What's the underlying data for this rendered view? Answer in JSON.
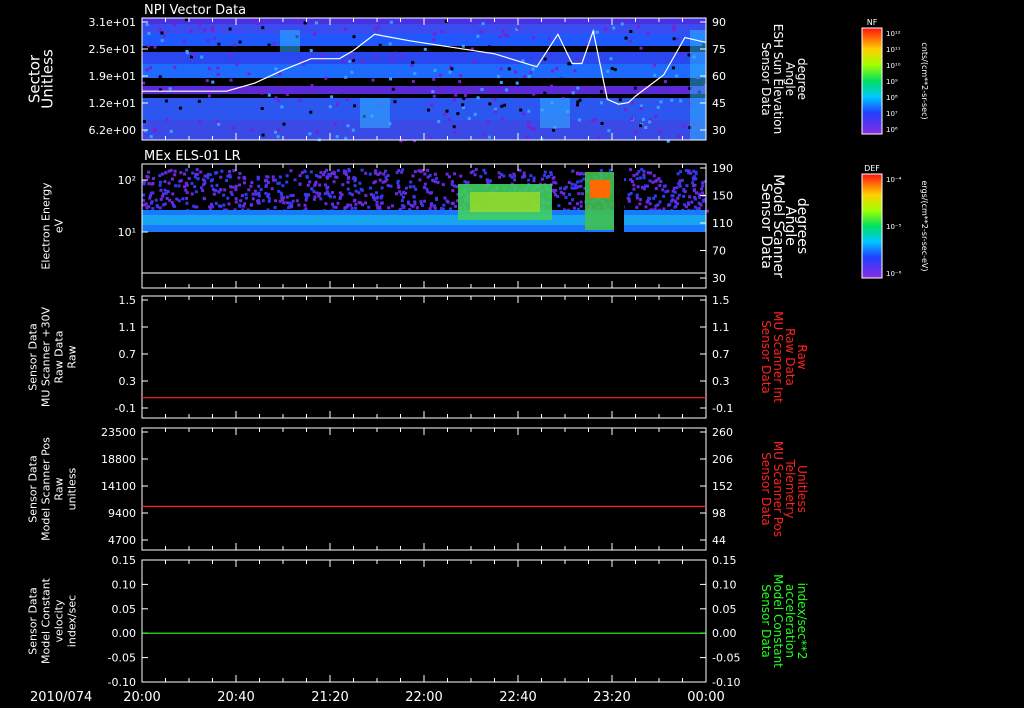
{
  "time_axis": {
    "date_label": "2010/074",
    "ticks": [
      "20:00",
      "20:40",
      "21:20",
      "22:00",
      "22:40",
      "23:20",
      "00:00"
    ],
    "range_hours": [
      20,
      24
    ]
  },
  "panels": [
    {
      "id": "npi",
      "title": "NPI Vector Data",
      "left_label": [
        "Sector",
        "Unitless"
      ],
      "left_ticks": [
        "3.1e+01",
        "2.5e+01",
        "1.9e+01",
        "1.2e+01",
        "6.2e+00"
      ],
      "right_label": [
        "Sensor Data",
        "ESH Sun Elevation",
        "Angle",
        "degree"
      ],
      "right_ticks": [
        "90",
        "75",
        "60",
        "45",
        "30"
      ],
      "right_label_color": "#ffffff",
      "colorbar": {
        "title": "NF",
        "units": "cnts/(cm**2-sr-sec)",
        "tick_labels": [
          "10¹²",
          "10¹¹",
          "10¹⁰",
          "10⁹",
          "10⁸",
          "10⁷",
          "10⁶"
        ]
      }
    },
    {
      "id": "els",
      "title": "MEx ELS-01 LR",
      "left_label": [
        "Electron Energy",
        "eV"
      ],
      "left_ticks": [
        "10²",
        "10¹"
      ],
      "right_label": [
        "Sensor Data",
        "Model Scanner",
        "Angle",
        "degrees"
      ],
      "right_ticks": [
        "190",
        "150",
        "110",
        "70",
        "30"
      ],
      "right_label_color": "#ffffff",
      "colorbar": {
        "title": "DEF",
        "units": "ergs/(cm**2-sr-sec-eV)",
        "tick_labels": [
          "10⁻⁴",
          "10⁻⁵",
          "10⁻⁶"
        ]
      }
    },
    {
      "id": "mu30v",
      "left_label": [
        "Sensor Data",
        "MU Scanner +30V",
        "Raw Data",
        "Raw"
      ],
      "left_ticks": [
        "1.5",
        "1.1",
        "0.7",
        "0.3",
        "-0.1"
      ],
      "right_label": [
        "Sensor Data",
        "MU Scanner Int",
        "Raw Data",
        "Raw"
      ],
      "right_ticks": [
        "1.5",
        "1.1",
        "0.7",
        "0.3",
        "-0.1"
      ],
      "right_label_color": "#ff2020"
    },
    {
      "id": "scanpos",
      "left_label": [
        "Sensor Data",
        "Model Scanner Pos",
        "Raw",
        "unitless"
      ],
      "left_ticks": [
        "23500",
        "18800",
        "14100",
        "9400",
        "4700"
      ],
      "right_label": [
        "Sensor Data",
        "MU Scanner Pos",
        "Telemetry",
        "Unitless"
      ],
      "right_ticks": [
        "260",
        "206",
        "152",
        "98",
        "44"
      ],
      "right_label_color": "#ff2020"
    },
    {
      "id": "velocity",
      "left_label": [
        "Sensor Data",
        "Model Constant",
        "velocity",
        "index/sec"
      ],
      "left_ticks": [
        "0.15",
        "0.10",
        "0.05",
        "0.00",
        "-0.05",
        "-0.10"
      ],
      "right_label": [
        "Sensor Data",
        "Model Constant",
        "acceleration",
        "index/sec**2"
      ],
      "right_ticks": [
        "0.15",
        "0.10",
        "0.05",
        "0.00",
        "-0.05",
        "-0.10"
      ],
      "right_label_color": "#20ff20"
    }
  ],
  "chart_data": [
    {
      "type": "heatmap",
      "title": "NPI Vector Data",
      "ylabel": "Sector Unitless",
      "x_range": [
        "20:00",
        "00:00"
      ],
      "y_ticks": [
        31,
        25,
        19,
        12,
        6.2
      ],
      "overlay_line": {
        "name": "Sensor Data ESH Sun Elevation Angle",
        "units": "degree",
        "y_range": [
          15,
          90
        ],
        "x_hours": [
          20.0,
          20.6,
          20.8,
          21.0,
          21.2,
          21.4,
          21.5,
          21.65,
          21.9,
          22.2,
          22.5,
          22.8,
          22.95,
          23.05,
          23.12,
          23.2,
          23.3,
          23.38,
          23.45,
          23.5,
          23.7,
          23.85,
          24.0
        ],
        "y_values": [
          45,
          45,
          50,
          58,
          65,
          65,
          70,
          80,
          76,
          72,
          68,
          60,
          80,
          62,
          62,
          82,
          40,
          37,
          38,
          42,
          55,
          78,
          75
        ],
        "color": "#ffffff"
      }
    },
    {
      "type": "heatmap",
      "title": "MEx ELS-01 LR",
      "ylabel": "Electron Energy eV",
      "y_scale": "log",
      "y_ticks": [
        10,
        100
      ],
      "overlay_line": {
        "name": "Sensor Data Model Scanner Angle",
        "units": "degrees",
        "value": 22,
        "color": "#ffffff"
      },
      "features": [
        {
          "from": "22:15",
          "to": "22:55",
          "level": "enhanced"
        },
        {
          "from": "23:06",
          "to": "23:12",
          "level": "peak"
        }
      ]
    },
    {
      "type": "line",
      "ylabel": "Sensor Data MU Scanner +30V Raw Data Raw",
      "ylim": [
        -0.3,
        1.5
      ],
      "series": [
        {
          "name": "Sensor Data MU Scanner Int Raw Data Raw",
          "value": 0.0,
          "color": "#ff2020"
        }
      ]
    },
    {
      "type": "line",
      "ylabel": "Sensor Data Model Scanner Pos Raw unitless",
      "ylim": [
        0,
        23500
      ],
      "series": [
        {
          "name": "Sensor Data MU Scanner Pos Telemetry Unitless",
          "value": 8400,
          "color": "#ff2020"
        }
      ]
    },
    {
      "type": "line",
      "ylabel": "Sensor Data Model Constant velocity index/sec",
      "ylim": [
        -0.1,
        0.15
      ],
      "series": [
        {
          "name": "Sensor Data Model Constant acceleration index/sec**2",
          "value": 0.0,
          "color": "#20ff20"
        }
      ]
    }
  ]
}
